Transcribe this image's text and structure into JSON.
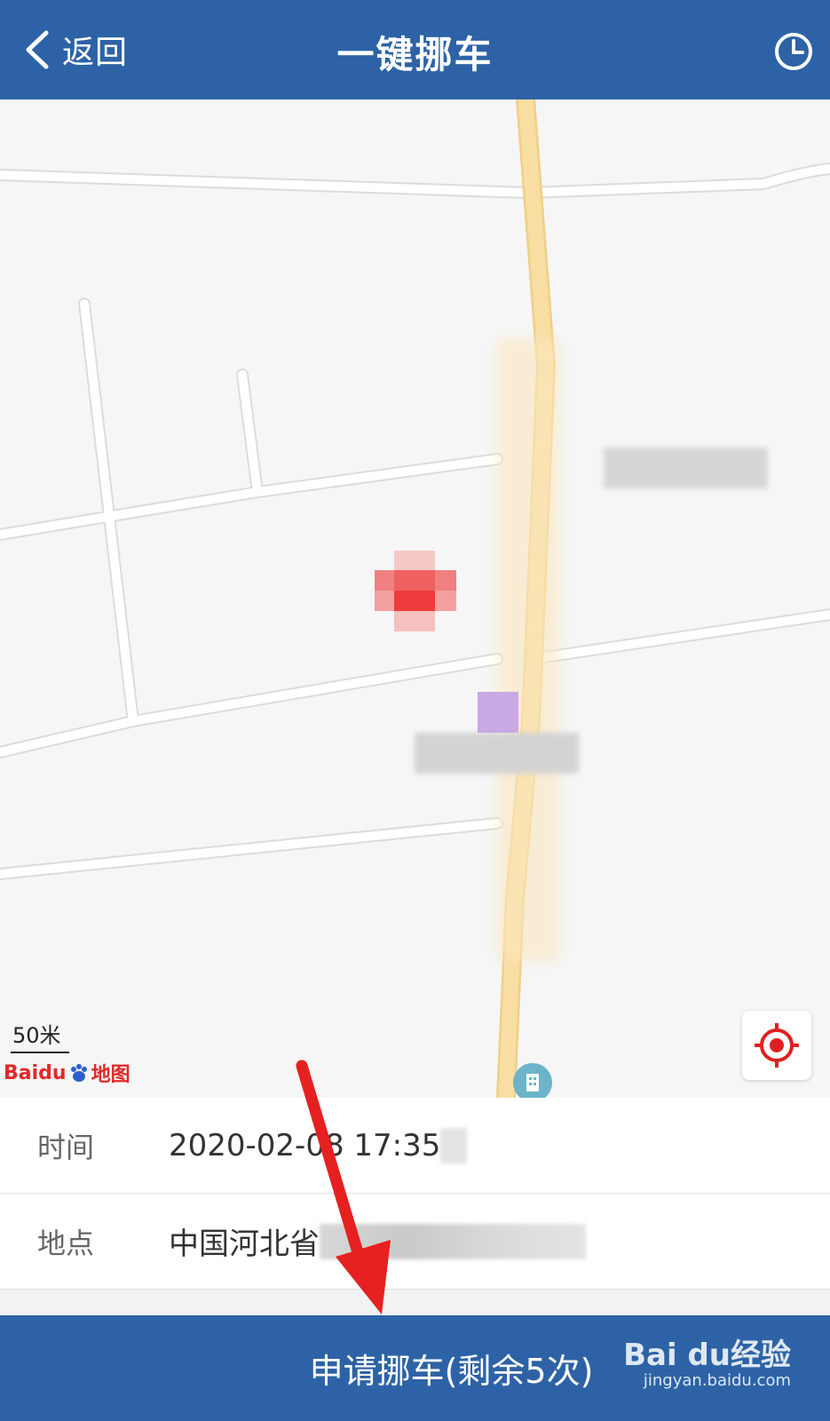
{
  "header": {
    "back_label": "返回",
    "title": "一键挪车"
  },
  "map": {
    "scale_label": "50米",
    "logo_text": "Baidu",
    "logo_suffix": "地图"
  },
  "info": {
    "time_label": "时间",
    "time_value": "2020-02-08 17:35",
    "location_label": "地点",
    "location_value": "中国河北省"
  },
  "bottom": {
    "apply_label": "申请挪车(剩余5次)"
  },
  "watermark": {
    "brand": "Bai du经验",
    "url": "jingyan.baidu.com"
  },
  "colors": {
    "header_bg": "#2d63a6",
    "road_main": "#f8d98f",
    "marker_red": "#ef3b3b",
    "annotation_arrow": "#e62020"
  }
}
